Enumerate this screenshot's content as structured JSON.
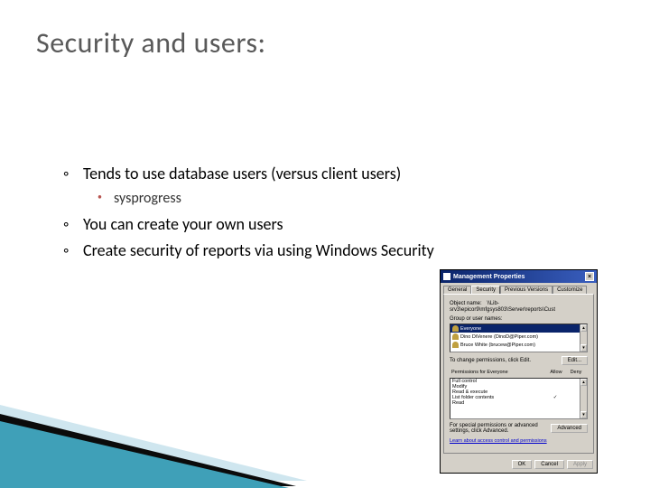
{
  "title": "Security and users:",
  "bullets": [
    {
      "text": "Tends to use database users (versus client users)",
      "sub": "sysprogress"
    },
    {
      "text": "You can create your own users"
    },
    {
      "text": "Create security of reports via using Windows Security"
    }
  ],
  "dialog": {
    "title": "Management Properties",
    "tabs": [
      "General",
      "Security",
      "Previous Versions",
      "Customize"
    ],
    "active_tab": 1,
    "object_name_label": "Object name:",
    "object_name": "\\\\Lib-srv3\\epicor9\\mfgsys803\\Server\\reports\\Cust",
    "groups_label": "Group or user names:",
    "groups": [
      "Everyone",
      "Dino DiVenere (DinoD@Piper.com)",
      "Bruce White (brucew@Piper.com)"
    ],
    "change_note": "To change permissions, click Edit.",
    "edit": "Edit...",
    "perm_label": "Permissions for Everyone",
    "allow": "Allow",
    "deny": "Deny",
    "perms": [
      {
        "name": "Full control",
        "allow": false
      },
      {
        "name": "Modify",
        "allow": false
      },
      {
        "name": "Read & execute",
        "allow": false
      },
      {
        "name": "List folder contents",
        "allow": true
      },
      {
        "name": "Read",
        "allow": false
      }
    ],
    "advanced_note": "For special permissions or advanced settings, click Advanced.",
    "advanced": "Advanced",
    "link": "Learn about access control and permissions",
    "ok": "OK",
    "cancel": "Cancel",
    "apply": "Apply"
  }
}
